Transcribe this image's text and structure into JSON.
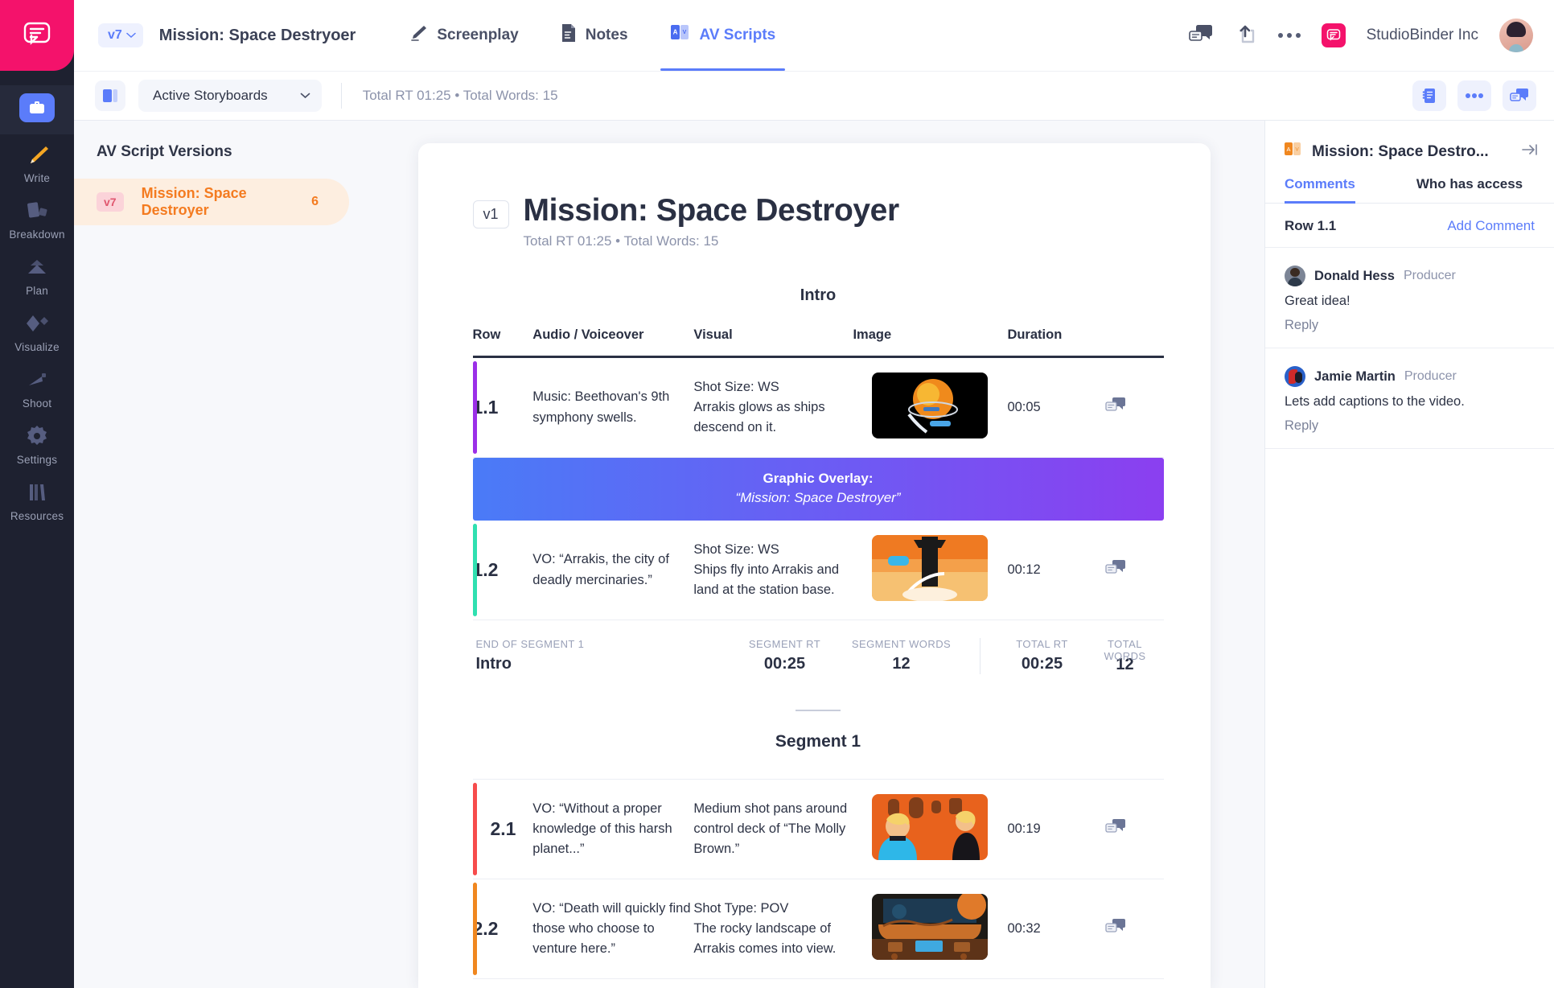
{
  "rail": {
    "logo_icon": "studiobinder-speech-logo",
    "items": [
      {
        "label": "",
        "icon": "briefcase-icon",
        "active": true
      },
      {
        "label": "Write",
        "icon": "pencil-icon",
        "active": false
      },
      {
        "label": "Breakdown",
        "icon": "cards-icon",
        "active": false
      },
      {
        "label": "Plan",
        "icon": "mountain-icon",
        "active": false
      },
      {
        "label": "Visualize",
        "icon": "shapes-icon",
        "active": false
      },
      {
        "label": "Shoot",
        "icon": "clapper-icon",
        "active": false
      },
      {
        "label": "Settings",
        "icon": "gear-icon",
        "active": false
      },
      {
        "label": "Resources",
        "icon": "books-icon",
        "active": false
      }
    ]
  },
  "topbar": {
    "version_chip": "v7",
    "project_title": "Mission: Space Destryoer",
    "tabs": [
      {
        "label": "Screenplay",
        "icon": "pencil-icon",
        "active": false
      },
      {
        "label": "Notes",
        "icon": "document-icon",
        "active": false
      },
      {
        "label": "AV Scripts",
        "icon": "av-icon",
        "active": true
      }
    ],
    "comments_icon": "comments-icon",
    "share_icon": "share-icon",
    "more_icon": "more-dots-icon",
    "org_name": "StudioBinder Inc",
    "org_icon": "studiobinder-logo-icon",
    "avatar": "user-avatar"
  },
  "subbar": {
    "layout_icon": "panel-layout-icon",
    "select_value": "Active Storyboards",
    "chevron_icon": "chevron-down-icon",
    "stats": "Total RT 01:25 • Total Words: 15",
    "buttons": [
      {
        "icon": "script-list-icon"
      },
      {
        "icon": "more-dots-icon"
      },
      {
        "icon": "comments-icon"
      }
    ]
  },
  "versions": {
    "title": "AV Script Versions",
    "items": [
      {
        "chip": "v7",
        "name": "Mission: Space Destroyer",
        "count": "6",
        "active": true
      }
    ]
  },
  "document": {
    "version_badge": "v1",
    "title": "Mission: Space Destroyer",
    "subtitle": "Total RT 01:25 • Total Words: 15",
    "section_title": "Intro",
    "columns": [
      "Row",
      "Audio / Voiceover",
      "Visual",
      "Image",
      "Duration"
    ],
    "rows": [
      {
        "type": "row",
        "num": "1.1",
        "accent": "#9b2fe8",
        "audio": "Music: Beethovan's 9th symphony swells.",
        "visual": "Shot Size: WS\nArrakis glows as ships descend on it.",
        "duration": "00:05",
        "thumb": "planet-arrakis-orange",
        "comment_icon": "comments-icon"
      },
      {
        "type": "overlay",
        "overlay_label": "Graphic Overlay:",
        "overlay_text": "“Mission: Space Destroyer”"
      },
      {
        "type": "row",
        "num": "1.2",
        "accent": "#2fe0b0",
        "audio": "VO: “Arrakis, the city of deadly mercinaries.”",
        "visual": "Shot Size: WS\nShips fly into Arrakis and land at the station base.",
        "duration": "00:12",
        "thumb": "tower-launch-orange",
        "comment_icon": "comments-icon"
      }
    ],
    "segment_footer": {
      "end_label": "END OF SEGMENT 1",
      "segment_name": "Intro",
      "cells": [
        {
          "cap": "SEGMENT RT",
          "val": "00:25"
        },
        {
          "cap": "SEGMENT WORDS",
          "val": "12"
        },
        {
          "cap": "TOTAL RT",
          "val": "00:25"
        },
        {
          "cap": "TOTAL WORDS",
          "val": "12"
        }
      ]
    },
    "segment2_heading": "Segment 1",
    "rows2": [
      {
        "type": "row",
        "num": "2.1",
        "accent": "#f74c4c",
        "audio": "VO: “Without a proper knowledge of this harsh planet...”",
        "visual": "Medium shot pans around control deck of “The Molly Brown.”",
        "duration": "00:19",
        "thumb": "comic-crew-control-deck",
        "comment_icon": "comments-icon"
      },
      {
        "type": "row",
        "num": "2.2",
        "accent": "#f0871f",
        "audio": "VO: “Death will quickly find those who choose to venture here.”",
        "visual": "Shot Type: POV\nThe rocky landscape of Arrakis comes into view.",
        "duration": "00:32",
        "thumb": "cockpit-pov-landscape",
        "comment_icon": "comments-icon"
      }
    ]
  },
  "right_panel": {
    "icon": "av-icon",
    "title": "Mission: Space Destro...",
    "collapse_icon": "collapse-right-icon",
    "tabs": [
      {
        "label": "Comments",
        "active": true
      },
      {
        "label": "Who has access",
        "active": false
      }
    ],
    "row_label": "Row 1.1",
    "add_comment": "Add Comment",
    "comments": [
      {
        "avatar": "donald-hess-avatar",
        "name": "Donald Hess",
        "role": "Producer",
        "body": "Great idea!",
        "reply": "Reply"
      },
      {
        "avatar": "jamie-martin-avatar",
        "name": "Jamie Martin",
        "role": "Producer",
        "body": "Lets add captions to the video.",
        "reply": "Reply"
      }
    ]
  },
  "colors": {
    "brand_pink": "#f4126b",
    "accent_blue": "#5b7cfa",
    "rail_dark": "#1e2130",
    "orange": "#f47b20"
  }
}
